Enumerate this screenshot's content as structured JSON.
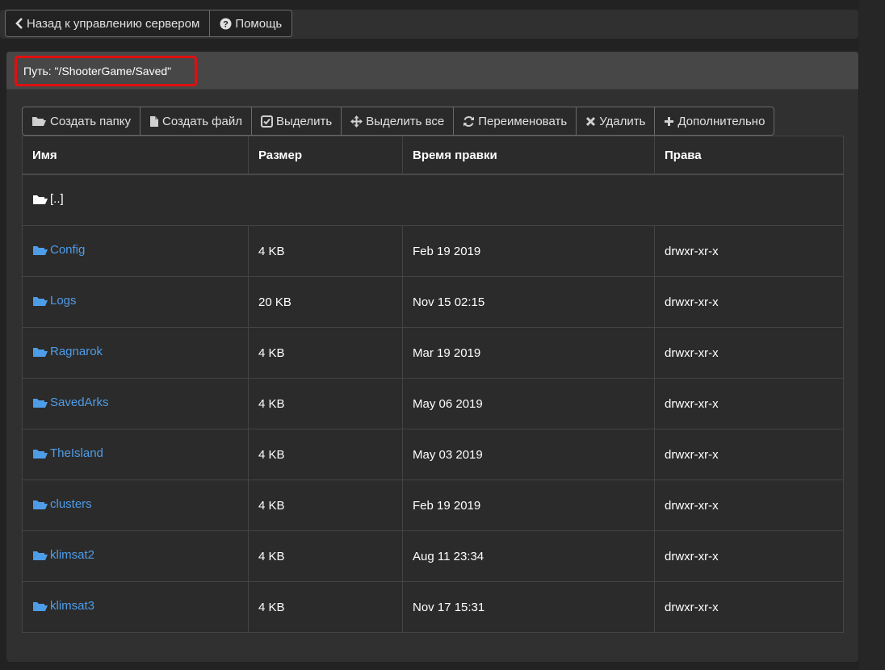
{
  "topbar": {
    "back_label": "Назад к управлению сервером",
    "help_label": "Помощь"
  },
  "path": {
    "label": "Путь: \"/ShooterGame/Saved\""
  },
  "toolbar": {
    "create_folder": "Создать папку",
    "create_file": "Создать файл",
    "select": "Выделить",
    "select_all": "Выделить все",
    "rename": "Переименовать",
    "delete": "Удалить",
    "more": "Дополнительно"
  },
  "table": {
    "headers": [
      "Имя",
      "Размер",
      "Время правки",
      "Права"
    ],
    "parent": "[..]",
    "rows": [
      {
        "name": "Config",
        "size": "4 KB",
        "mtime": "Feb 19 2019",
        "perms": "drwxr-xr-x"
      },
      {
        "name": "Logs",
        "size": "20 KB",
        "mtime": "Nov 15 02:15",
        "perms": "drwxr-xr-x"
      },
      {
        "name": "Ragnarok",
        "size": "4 KB",
        "mtime": "Mar 19 2019",
        "perms": "drwxr-xr-x"
      },
      {
        "name": "SavedArks",
        "size": "4 KB",
        "mtime": "May 06 2019",
        "perms": "drwxr-xr-x"
      },
      {
        "name": "TheIsland",
        "size": "4 KB",
        "mtime": "May 03 2019",
        "perms": "drwxr-xr-x"
      },
      {
        "name": "clusters",
        "size": "4 KB",
        "mtime": "Feb 19 2019",
        "perms": "drwxr-xr-x"
      },
      {
        "name": "klimsat2",
        "size": "4 KB",
        "mtime": "Aug 11 23:34",
        "perms": "drwxr-xr-x"
      },
      {
        "name": "klimsat3",
        "size": "4 KB",
        "mtime": "Nov 17 15:31",
        "perms": "drwxr-xr-x"
      }
    ]
  },
  "colors": {
    "link": "#4e9de8",
    "highlight_border": "#e01010",
    "background": "#222222"
  },
  "icons": [
    "chevron-left-icon",
    "question-circle-icon",
    "folder-open-icon",
    "file-icon",
    "check-square-icon",
    "move-icon",
    "refresh-icon",
    "times-icon",
    "plus-icon"
  ]
}
